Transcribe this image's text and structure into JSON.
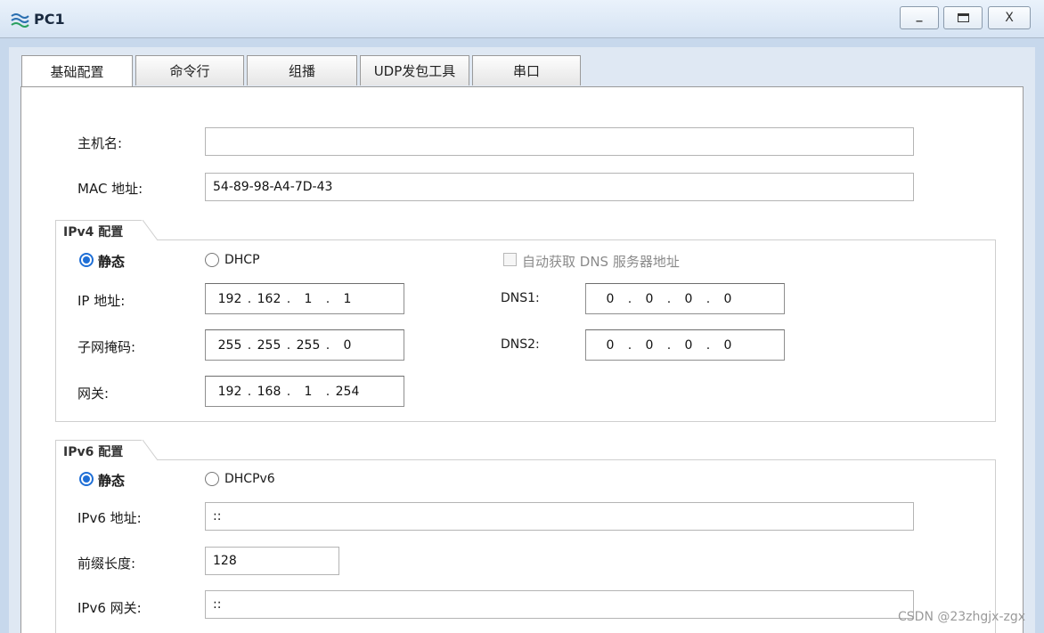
{
  "window": {
    "title": "PC1",
    "min_label": "_",
    "close_label": "X"
  },
  "tabs": [
    "基础配置",
    "命令行",
    "组播",
    "UDP发包工具",
    "串口"
  ],
  "basic": {
    "hostname_label": "主机名:",
    "hostname_value": "",
    "mac_label": "MAC 地址:",
    "mac_value": "54-89-98-A4-7D-43"
  },
  "ipv4": {
    "group_title": "IPv4 配置",
    "static_label": "静态",
    "dhcp_label": "DHCP",
    "auto_dns_label": "自动获取 DNS 服务器地址",
    "ip_label": "IP 地址:",
    "ip": [
      "192",
      "162",
      "1",
      "1"
    ],
    "mask_label": "子网掩码:",
    "mask": [
      "255",
      "255",
      "255",
      "0"
    ],
    "gateway_label": "网关:",
    "gateway": [
      "192",
      "168",
      "1",
      "254"
    ],
    "dns1_label": "DNS1:",
    "dns1": [
      "0",
      "0",
      "0",
      "0"
    ],
    "dns2_label": "DNS2:",
    "dns2": [
      "0",
      "0",
      "0",
      "0"
    ]
  },
  "ipv6": {
    "group_title": "IPv6 配置",
    "static_label": "静态",
    "dhcp_label": "DHCPv6",
    "addr_label": "IPv6 地址:",
    "addr_value": "::",
    "prefix_label": "前缀长度:",
    "prefix_value": "128",
    "gateway_label": "IPv6 网关:",
    "gateway_value": "::"
  },
  "watermark": "CSDN @23zhgjx-zgx",
  "colors": {
    "accent": "#1f6fd6",
    "titlebar": "#d5e3f3",
    "frame": "#c7d8ec"
  }
}
